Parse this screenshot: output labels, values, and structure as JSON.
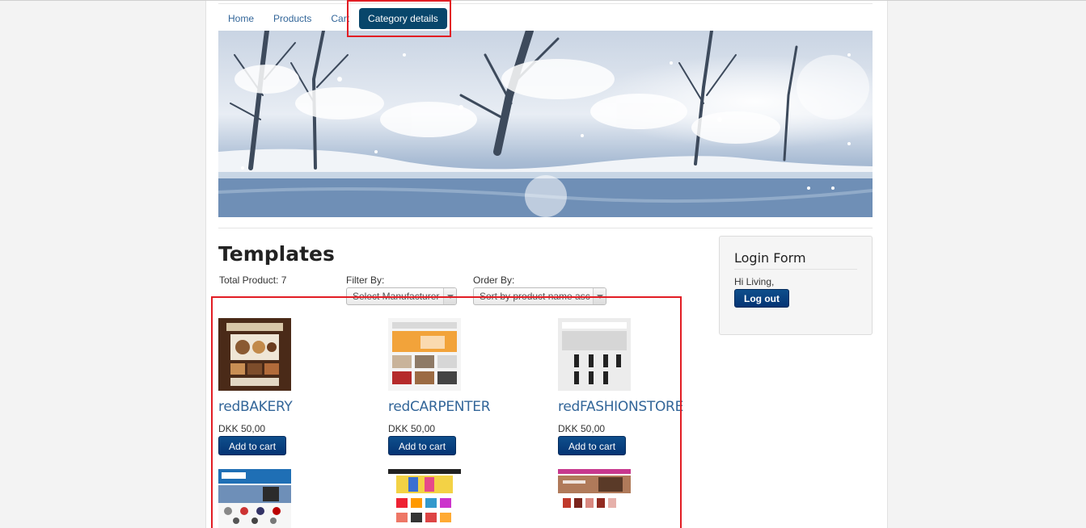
{
  "nav": {
    "items": [
      {
        "label": "Home"
      },
      {
        "label": "Products"
      },
      {
        "label": "Cart"
      },
      {
        "label": "Category details",
        "active": true
      }
    ]
  },
  "category": {
    "title": "Templates",
    "total_label": "Total Product: 7",
    "filter_label": "Filter By:",
    "filter_value": "Select Manufacturer",
    "order_label": "Order By:",
    "order_value": "Sort by product name asc"
  },
  "products": [
    {
      "name": "redBAKERY",
      "price": "DKK 50,00",
      "button": "Add to cart",
      "thumb": "bakery-thumbnail"
    },
    {
      "name": "redCARPENTER",
      "price": "DKK 50,00",
      "button": "Add to cart",
      "thumb": "carpenter-thumbnail"
    },
    {
      "name": "redFASHIONSTORE",
      "price": "DKK 50,00",
      "button": "Add to cart",
      "thumb": "fashionstore-thumbnail"
    },
    {
      "thumb": "gadgets-thumbnail"
    },
    {
      "thumb": "toys-thumbnail"
    },
    {
      "thumb": "fashion-shoes-thumbnail"
    }
  ],
  "login": {
    "title": "Login Form",
    "greeting": "Hi Living,",
    "logout_label": "Log out"
  },
  "colors": {
    "accent": "#08466b",
    "link": "#336699",
    "button": "#043474",
    "highlight": "#e21d24"
  }
}
